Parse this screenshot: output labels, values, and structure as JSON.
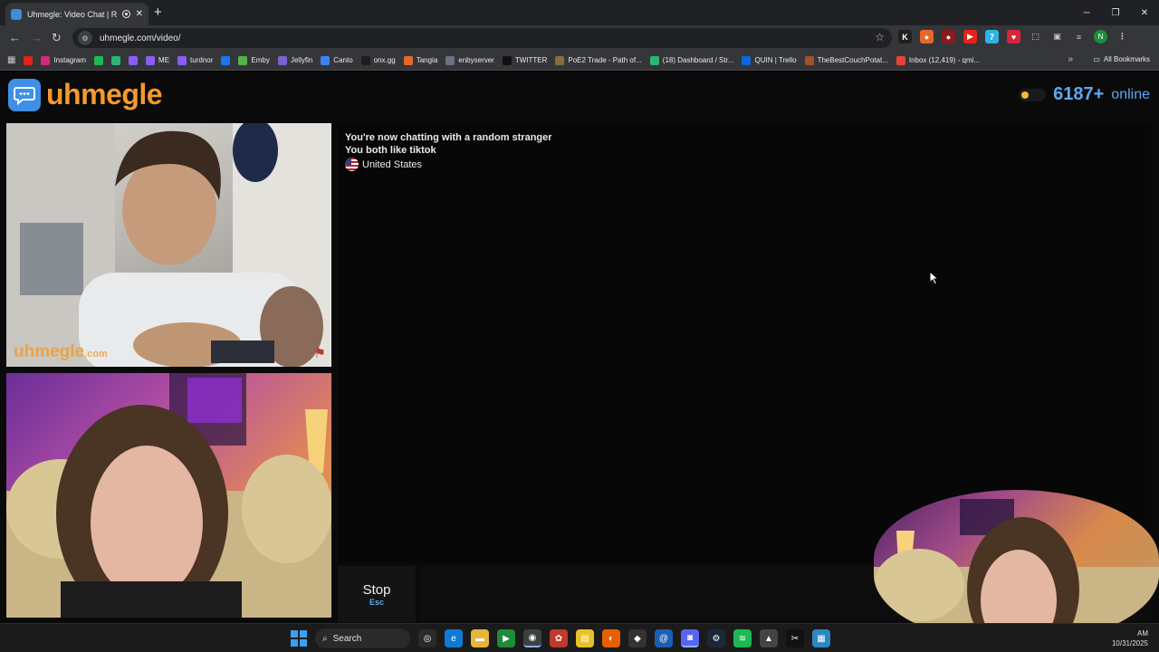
{
  "browser": {
    "tab_title": "Uhmegle: Video Chat | Random",
    "url": "uhmegle.com/video/",
    "window_controls": [
      "─",
      "❐",
      "✕"
    ],
    "profile_initial": "N",
    "extensions": [
      {
        "name": "k-extension-icon",
        "glyph": "K",
        "color": "#1f1f1f"
      },
      {
        "name": "fox-extension-icon",
        "glyph": "●",
        "color": "#e8682b"
      },
      {
        "name": "ublock-extension-icon",
        "glyph": "●",
        "color": "#8b1a1a"
      },
      {
        "name": "youtube-extension-icon",
        "glyph": "▶",
        "color": "#e62117"
      },
      {
        "name": "7tv-extension-icon",
        "glyph": "7",
        "color": "#2bb4e6"
      },
      {
        "name": "heart-extension-icon",
        "glyph": "♥",
        "color": "#d6263a"
      },
      {
        "name": "puzzle-extension-icon",
        "glyph": "⬚",
        "color": "#35363a"
      }
    ]
  },
  "bookmarks": [
    {
      "label": "",
      "color": "#e62117"
    },
    {
      "label": "Instagram",
      "color": "#d6287a"
    },
    {
      "label": "",
      "color": "#1db954"
    },
    {
      "label": "",
      "color": "#2bb673"
    },
    {
      "label": "",
      "color": "#8b5cf6"
    },
    {
      "label": "ME",
      "color": "#8b5cf6"
    },
    {
      "label": "turdnor",
      "color": "#8b5cf6"
    },
    {
      "label": "",
      "color": "#1877f2"
    },
    {
      "label": "Emby",
      "color": "#52b54b"
    },
    {
      "label": "Jellyfin",
      "color": "#7b61d1"
    },
    {
      "label": "Canto",
      "color": "#3b82f6"
    },
    {
      "label": "onx.gg",
      "color": "#1e1e1e"
    },
    {
      "label": "Tangia",
      "color": "#e8682b"
    },
    {
      "label": "enbyserver",
      "color": "#6b7280"
    },
    {
      "label": "TWITTER",
      "color": "#111111"
    },
    {
      "label": "PoE2 Trade - Path of...",
      "color": "#8a6d3b"
    },
    {
      "label": "(18) Dashboard / Str...",
      "color": "#2bb673"
    },
    {
      "label": "QUIN | Trello",
      "color": "#0c66e4"
    },
    {
      "label": "TheBestCouchPotat...",
      "color": "#a0522d"
    },
    {
      "label": "Inbox (12,419) - qmi...",
      "color": "#ea4335"
    }
  ],
  "all_bookmarks": "All Bookmarks",
  "site": {
    "logo_text": "uhmegle",
    "online_count": "6187+",
    "online_label": "online",
    "watermark": "uhmegle",
    "watermark_suffix": ".com"
  },
  "chat": {
    "line1": "You're now chatting with a random stranger",
    "line2": "You both like tiktok",
    "country": "United States"
  },
  "controls": {
    "stop_label": "Stop",
    "stop_key": "Esc"
  },
  "taskbar": {
    "search_label": "Search",
    "apps": [
      {
        "name": "copilot-icon",
        "glyph": "◎",
        "color": "#2a2a2a"
      },
      {
        "name": "edge-icon",
        "glyph": "e",
        "color": "#0f7bd6"
      },
      {
        "name": "file-explorer-icon",
        "glyph": "▬",
        "color": "#e8b43a"
      },
      {
        "name": "media-player-icon",
        "glyph": "▶",
        "color": "#1f8c3a"
      },
      {
        "name": "chrome-icon",
        "glyph": "◉",
        "color": "#3c4043"
      },
      {
        "name": "app-red-icon",
        "glyph": "✿",
        "color": "#c0392b"
      },
      {
        "name": "sticky-notes-icon",
        "glyph": "▤",
        "color": "#e6c229"
      },
      {
        "name": "firefox-icon",
        "glyph": "◐",
        "color": "#e66000"
      },
      {
        "name": "inkscape-icon",
        "glyph": "◆",
        "color": "#333333"
      },
      {
        "name": "mail-icon",
        "glyph": "@",
        "color": "#1a5fb4"
      },
      {
        "name": "discord-icon",
        "glyph": "◙",
        "color": "#5865f2"
      },
      {
        "name": "steam-icon",
        "glyph": "⚙",
        "color": "#1b2838"
      },
      {
        "name": "spotify-icon",
        "glyph": "≋",
        "color": "#1db954"
      },
      {
        "name": "pinned-app-icon",
        "glyph": "▲",
        "color": "#444444"
      },
      {
        "name": "capcut-icon",
        "glyph": "✂",
        "color": "#111111"
      },
      {
        "name": "notepad-icon",
        "glyph": "▦",
        "color": "#2e86c1"
      }
    ],
    "time": "AM",
    "date": "10/31/2025"
  }
}
